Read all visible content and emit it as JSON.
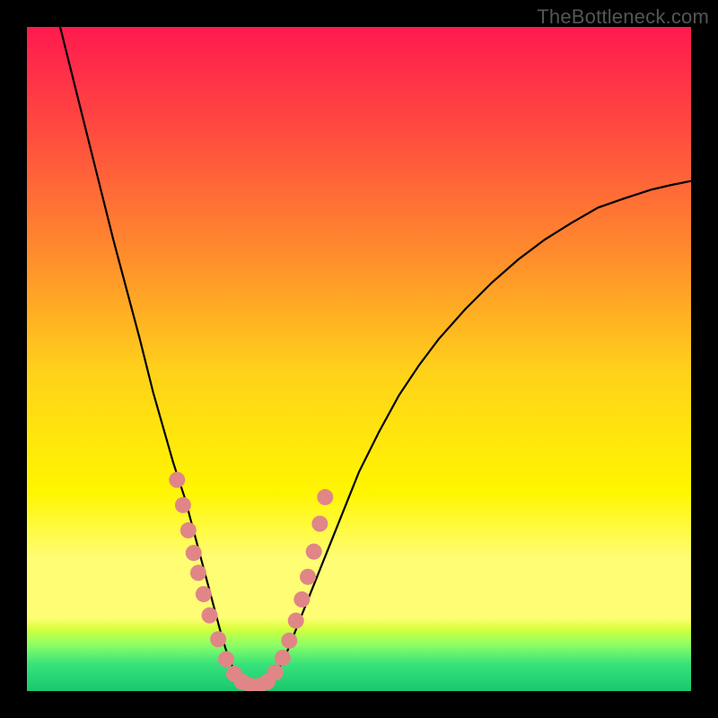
{
  "watermark": "TheBottleneck.com",
  "chart_data": {
    "type": "line",
    "title": "",
    "xlabel": "",
    "ylabel": "",
    "xlim": [
      0,
      100
    ],
    "ylim": [
      0,
      100
    ],
    "grid": false,
    "legend": false,
    "background_gradient_stops": [
      {
        "offset": 0.0,
        "color": "#ff1a4f"
      },
      {
        "offset": 0.16,
        "color": "#ff4c3f"
      },
      {
        "offset": 0.34,
        "color": "#ff8b2d"
      },
      {
        "offset": 0.52,
        "color": "#ffd21a"
      },
      {
        "offset": 0.7,
        "color": "#fff600"
      },
      {
        "offset": 0.8,
        "color": "#fffd74"
      },
      {
        "offset": 0.89,
        "color": "#fffd74"
      },
      {
        "offset": 0.905,
        "color": "#d9ff3f"
      },
      {
        "offset": 0.93,
        "color": "#8dff63"
      },
      {
        "offset": 0.96,
        "color": "#38e27b"
      },
      {
        "offset": 1.0,
        "color": "#19c76f"
      }
    ],
    "series": [
      {
        "name": "curve",
        "color": "#000000",
        "width": 2.2,
        "x": [
          5,
          7,
          9,
          11,
          13,
          15,
          17,
          18,
          19,
          20,
          21,
          22,
          22.8,
          23.8,
          24.6,
          25.4,
          26.2,
          27,
          27.8,
          28.6,
          29.4,
          30.2,
          31,
          32,
          33,
          34,
          35,
          36,
          37,
          38,
          39,
          40,
          42,
          44,
          46,
          48,
          50,
          53,
          56,
          59,
          62,
          66,
          70,
          74,
          78,
          82,
          86,
          90,
          94,
          97,
          100
        ],
        "y": [
          100,
          92,
          84,
          76,
          68,
          60.5,
          53,
          49,
          45,
          41.5,
          38,
          34.5,
          32,
          29,
          26,
          23,
          20,
          17,
          14,
          11,
          8,
          5.5,
          3.5,
          2,
          1,
          0.5,
          0.5,
          1,
          2,
          3.5,
          5.5,
          8,
          13,
          18,
          23,
          28,
          33,
          39,
          44.5,
          49,
          53,
          57.5,
          61.5,
          65,
          68,
          70.5,
          72.8,
          74.2,
          75.5,
          76.2,
          76.8
        ]
      }
    ],
    "markers": {
      "name": "overlay-dots",
      "color": "#e08686",
      "radius": 9,
      "x": [
        22.6,
        23.5,
        24.3,
        25.1,
        25.8,
        26.6,
        27.5,
        28.8,
        30.0,
        31.2,
        32.4,
        33.7,
        35.0,
        36.2,
        37.4,
        38.5,
        39.5,
        40.5,
        41.4,
        42.3,
        43.2,
        44.1,
        44.9
      ],
      "y": [
        31.8,
        28.0,
        24.2,
        20.8,
        17.8,
        14.6,
        11.4,
        7.8,
        4.8,
        2.6,
        1.4,
        0.8,
        0.8,
        1.4,
        2.8,
        5.0,
        7.6,
        10.6,
        13.8,
        17.2,
        21.0,
        25.2,
        29.2
      ]
    }
  }
}
